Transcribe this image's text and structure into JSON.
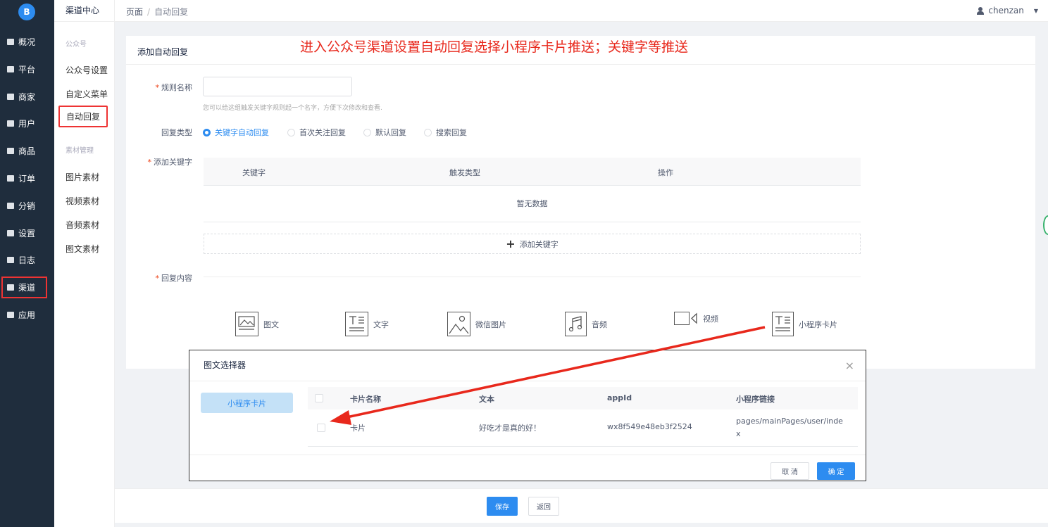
{
  "app": {
    "logo_text": "B"
  },
  "nav": {
    "items": [
      {
        "label": "概况",
        "icon": "dashboard-icon"
      },
      {
        "label": "平台",
        "icon": "monitor-icon"
      },
      {
        "label": "商家",
        "icon": "store-icon"
      },
      {
        "label": "用户",
        "icon": "user-icon"
      },
      {
        "label": "商品",
        "icon": "goods-icon"
      },
      {
        "label": "订单",
        "icon": "order-icon"
      },
      {
        "label": "分销",
        "icon": "distribution-icon"
      },
      {
        "label": "设置",
        "icon": "gear-icon"
      },
      {
        "label": "日志",
        "icon": "log-icon"
      },
      {
        "label": "渠道",
        "icon": "channel-icon"
      },
      {
        "label": "应用",
        "icon": "apps-icon"
      }
    ],
    "active": "渠道"
  },
  "subnav": {
    "title": "渠道中心",
    "group1": "公众号",
    "items1": [
      "公众号设置",
      "自定义菜单",
      "自动回复"
    ],
    "group2": "素材管理",
    "items2": [
      "图片素材",
      "视频素材",
      "音频素材",
      "图文素材"
    ],
    "selected": "自动回复"
  },
  "breadcrumb": {
    "root": "页面",
    "sep": "/",
    "current": "自动回复"
  },
  "user": {
    "name": "chenzan"
  },
  "annotation": "进入公众号渠道设置自动回复选择小程序卡片推送；关键字等推送",
  "form": {
    "title": "添加自动回复",
    "rule_name_label": "规则名称",
    "rule_name_value": "",
    "rule_name_hint": "您可以给这组触发关键字规则起一个名字，方便下次修改和查看.",
    "reply_type_label": "回复类型",
    "reply_types": [
      "关键字自动回复",
      "首次关注回复",
      "默认回复",
      "搜索回复"
    ],
    "reply_type_selected": "关键字自动回复",
    "keywords_label": "添加关键字",
    "keyword_columns": [
      "关键字",
      "触发类型",
      "操作"
    ],
    "keyword_empty": "暂无数据",
    "add_keyword": "添加关键字",
    "content_label": "回复内容",
    "content_types": [
      {
        "label": "图文",
        "icon": "image-text-icon"
      },
      {
        "label": "文字",
        "icon": "text-icon"
      },
      {
        "label": "微信图片",
        "icon": "image-icon"
      },
      {
        "label": "音频",
        "icon": "audio-icon"
      },
      {
        "label": "视频",
        "icon": "video-icon"
      },
      {
        "label": "小程序卡片",
        "icon": "mini-program-card-icon"
      }
    ]
  },
  "footer": {
    "save": "保存",
    "back": "返回"
  },
  "modal": {
    "title": "图文选择器",
    "close": "×",
    "tab": "小程序卡片",
    "columns": [
      "卡片名称",
      "文本",
      "appId",
      "小程序链接"
    ],
    "rows": [
      {
        "name": "卡片",
        "text": "好吃才是真的好！",
        "appid": "wx8f549e48eb3f2524",
        "link1": "pages/mainPages/user/inde",
        "link2": "x"
      }
    ],
    "cancel": "取 消",
    "ok": "确 定"
  }
}
